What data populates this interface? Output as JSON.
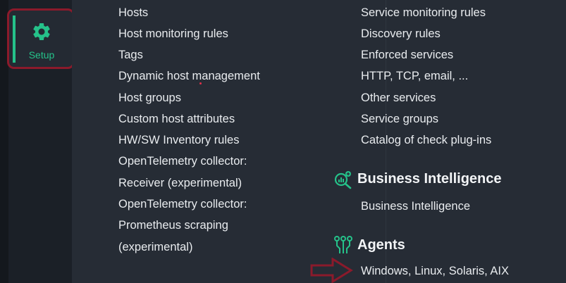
{
  "sidebar": {
    "setup_label": "Setup",
    "setup_icon": "gear-icon",
    "accent_color": "#25c28a",
    "highlight_color": "#8b1a2b"
  },
  "hosts_column": {
    "items": [
      "Hosts",
      "Host monitoring rules",
      "Tags",
      "Dynamic host management",
      "Host groups",
      "Custom host attributes",
      "HW/SW Inventory rules",
      "OpenTelemetry collector:",
      "Receiver (experimental)",
      "OpenTelemetry collector:",
      "Prometheus scraping",
      "(experimental)"
    ]
  },
  "services_column": {
    "items": [
      "Service monitoring rules",
      "Discovery rules",
      "Enforced services",
      "HTTP, TCP, email, ...",
      "Other services",
      "Service groups",
      "Catalog of check plug-ins"
    ]
  },
  "business_intelligence": {
    "title": "Business Intelligence",
    "icon": "business-intelligence-icon",
    "items": [
      "Business Intelligence"
    ]
  },
  "agents": {
    "title": "Agents",
    "icon": "agents-icon",
    "items": [
      "Windows, Linux, Solaris, AIX"
    ]
  }
}
